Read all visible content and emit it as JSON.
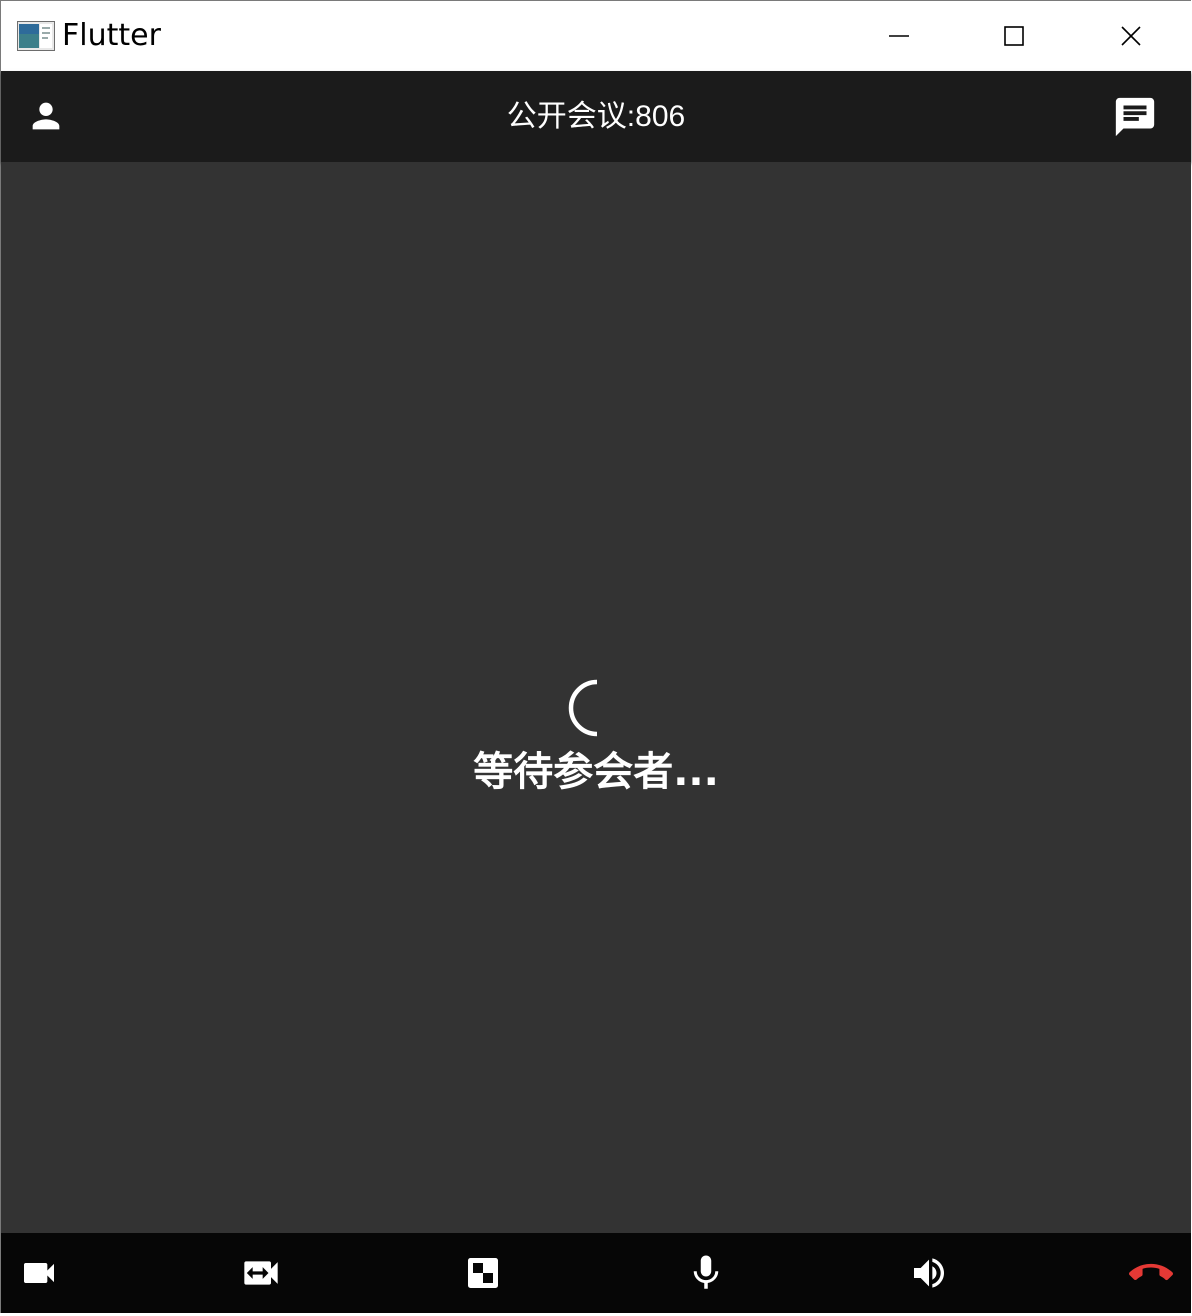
{
  "window": {
    "title": "Flutter",
    "icons": {
      "app": "flutter-app-icon",
      "minimize": "minimize-icon",
      "maximize": "maximize-icon",
      "close": "close-icon"
    }
  },
  "appbar": {
    "title": "公开会议:806",
    "leading_icon": "person-icon",
    "trailing_icon": "chat-icon"
  },
  "main": {
    "status_text": "等待参会者...",
    "spinner_icon": "loading-spinner"
  },
  "toolbar": {
    "buttons": [
      {
        "name": "video-camera",
        "icon": "videocam-icon"
      },
      {
        "name": "switch-camera",
        "icon": "switch-video-icon"
      },
      {
        "name": "layout",
        "icon": "flip-layout-icon"
      },
      {
        "name": "microphone",
        "icon": "mic-icon"
      },
      {
        "name": "speaker",
        "icon": "volume-up-icon"
      },
      {
        "name": "hang-up",
        "icon": "call-end-icon"
      }
    ]
  },
  "colors": {
    "titlebar": "#ffffff",
    "appbar": "#1b1b1b",
    "stage": "#333333",
    "toolbar": "#060606",
    "icon": "#ffffff",
    "hangup": "#e53935"
  }
}
